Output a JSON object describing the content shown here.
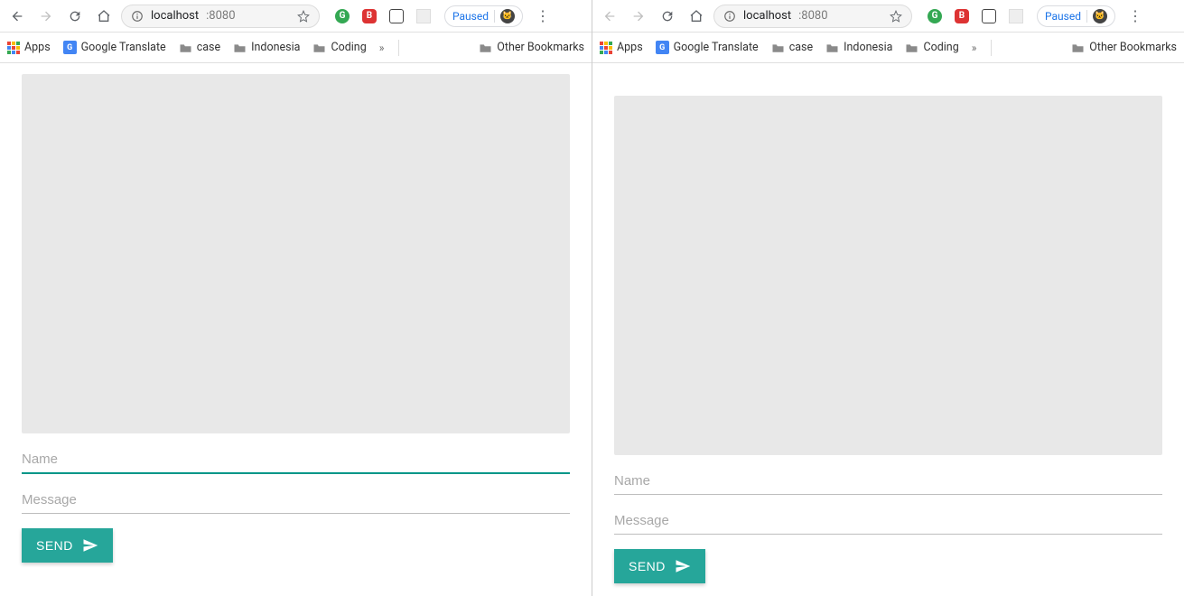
{
  "browser": {
    "url_host": "localhost",
    "url_port": ":8080",
    "paused_label": "Paused"
  },
  "bookmarks": {
    "apps": "Apps",
    "google_translate": "Google Translate",
    "case": "case",
    "indonesia": "Indonesia",
    "coding": "Coding",
    "other": "Other Bookmarks",
    "overflow": "»"
  },
  "form": {
    "name_placeholder": "Name",
    "message_placeholder": "Message",
    "send_label": "SEND"
  }
}
